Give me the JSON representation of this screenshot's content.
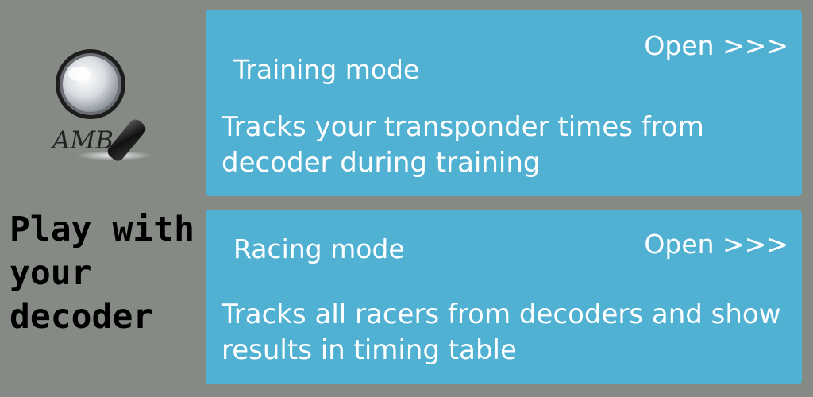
{
  "logo": {
    "icon": "magnifier-icon",
    "text": "AMB"
  },
  "tagline": "Play with\nyour\ndecoder",
  "modes": [
    {
      "title": "Training mode",
      "open_label": "Open >>>",
      "description": "Tracks your transponder times from decoder during training"
    },
    {
      "title": "Racing mode",
      "open_label": "Open >>>",
      "description": "Tracks all racers from decoders and show results in timing table"
    }
  ],
  "colors": {
    "background": "#858a85",
    "card": "#51b1d3",
    "text_on_card": "#ffffff"
  }
}
